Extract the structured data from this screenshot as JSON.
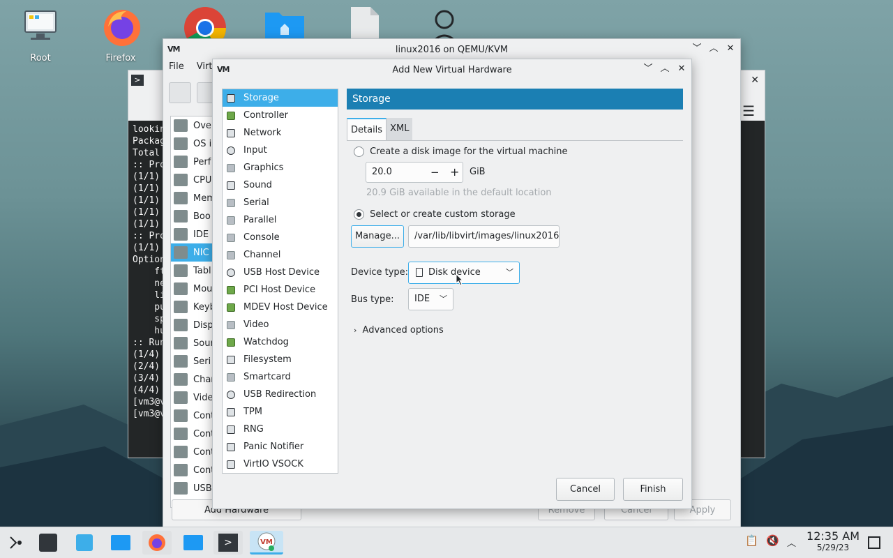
{
  "desktop": {
    "icons": [
      {
        "label": "Root"
      },
      {
        "label": "Firefox"
      },
      {
        "label": ""
      },
      {
        "label": ""
      },
      {
        "label": ""
      },
      {
        "label": ""
      }
    ]
  },
  "terminal": {
    "lines": [
      "lookin",
      "",
      "Packag",
      "",
      "Total ",
      "",
      ":: Pro",
      "(1/1) ",
      "(1/1) ",
      "(1/1) ",
      "(1/1) ",
      "(1/1) ",
      ":: Pro",
      "(1/1) ",
      "Option",
      "    ft",
      "    ne",
      "    li",
      "    pu",
      "    sp",
      "    hu",
      ":: Run",
      "(1/4) ",
      "(2/4) ",
      "(3/4) ",
      "(4/4) ",
      "[vm3@v",
      "[vm3@v"
    ]
  },
  "vm_window": {
    "title": "linux2016 on QEMU/KVM",
    "menu": [
      "File",
      "Virt"
    ],
    "hw_items": [
      "Ove",
      "OS in",
      "Perf",
      "CPU",
      "Mem",
      "Boo",
      "IDE",
      "NIC",
      "Tabl",
      "Mou",
      "Keyb",
      "Disp",
      "Soun",
      "Seri",
      "Chan",
      "Vide",
      "Cont",
      "Cont",
      "Cont",
      "Cont",
      "USB"
    ],
    "add_hardware": "Add Hardware",
    "remove": "Remove",
    "cancel": "Cancel",
    "apply": "Apply"
  },
  "dialog": {
    "title": "Add New Virtual Hardware",
    "categories": [
      {
        "label": "Storage",
        "icon": "disk-icon",
        "selected": true
      },
      {
        "label": "Controller",
        "icon": "card-icon"
      },
      {
        "label": "Network",
        "icon": "network-icon"
      },
      {
        "label": "Input",
        "icon": "mouse-icon"
      },
      {
        "label": "Graphics",
        "icon": "monitor-icon"
      },
      {
        "label": "Sound",
        "icon": "sound-icon"
      },
      {
        "label": "Serial",
        "icon": "serial-icon"
      },
      {
        "label": "Parallel",
        "icon": "parallel-icon"
      },
      {
        "label": "Console",
        "icon": "console-icon"
      },
      {
        "label": "Channel",
        "icon": "channel-icon"
      },
      {
        "label": "USB Host Device",
        "icon": "usb-icon"
      },
      {
        "label": "PCI Host Device",
        "icon": "pci-icon"
      },
      {
        "label": "MDEV Host Device",
        "icon": "mdev-icon"
      },
      {
        "label": "Video",
        "icon": "video-icon"
      },
      {
        "label": "Watchdog",
        "icon": "watchdog-icon"
      },
      {
        "label": "Filesystem",
        "icon": "folder-icon"
      },
      {
        "label": "Smartcard",
        "icon": "smartcard-icon"
      },
      {
        "label": "USB Redirection",
        "icon": "usb-redirect-icon"
      },
      {
        "label": "TPM",
        "icon": "chip-icon"
      },
      {
        "label": "RNG",
        "icon": "rng-icon"
      },
      {
        "label": "Panic Notifier",
        "icon": "panic-icon"
      },
      {
        "label": "VirtIO VSOCK",
        "icon": "vsock-icon"
      }
    ],
    "panel_title": "Storage",
    "tabs": [
      "Details",
      "XML"
    ],
    "create_disk_label": "Create a disk image for the virtual machine",
    "disk_size": "20.0",
    "disk_unit": "GiB",
    "available_text": "20.9 GiB available in the default location",
    "custom_storage_label": "Select or create custom storage",
    "manage_label": "Manage...",
    "storage_path": "/var/lib/libvirt/images/linux2016",
    "device_type_label": "Device type:",
    "device_type_value": "Disk device",
    "bus_type_label": "Bus type:",
    "bus_type_value": "IDE",
    "advanced_label": "Advanced options",
    "cancel_label": "Cancel",
    "finish_label": "Finish"
  },
  "taskbar": {
    "time": "12:35 AM",
    "date": "5/29/23"
  },
  "colors": {
    "accent": "#3daee9",
    "panel_header": "#1b7fb3"
  }
}
